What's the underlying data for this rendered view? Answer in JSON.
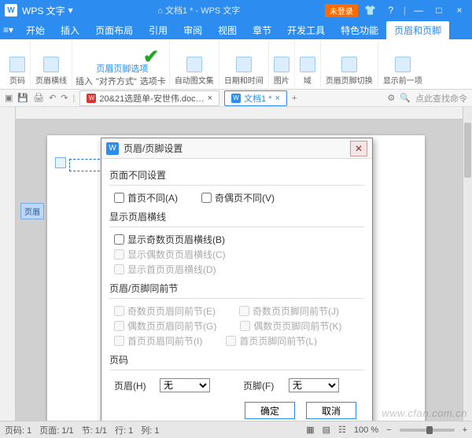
{
  "titlebar": {
    "app": "WPS 文字",
    "center": "⌂ 文档1 * - WPS 文字",
    "login": "未登录",
    "icons": {
      "shirt": "👕",
      "help": "?",
      "min": "—",
      "max": "□",
      "close": "×"
    }
  },
  "menubar": {
    "tabs": [
      "开始",
      "插入",
      "页面布局",
      "引用",
      "审阅",
      "视图",
      "章节",
      "开发工具",
      "特色功能",
      "页眉和页脚"
    ]
  },
  "ribbon": {
    "pagenum": "页码",
    "headerline": "页眉横线",
    "insert": "插入",
    "align": "\"对齐方式\"",
    "options_line1": "页眉页脚选项",
    "options_line2": "选项卡",
    "autotext": "自动图文集",
    "datetime": "日期和时间",
    "picture": "图片",
    "field": "域",
    "switch": "页眉页脚切换",
    "showprev": "显示前一项"
  },
  "quick": {
    "doc1_name": "20&21选题单-安世伟.doc…",
    "doc2_name": "文档1 *",
    "search": "点此查找命令"
  },
  "pagepanel": {
    "header_tag": "页眉"
  },
  "dialog": {
    "title": "页眉/页脚设置",
    "sec_page": "页面不同设置",
    "first_diff": "首页不同(A)",
    "oddeven_diff": "奇偶页不同(V)",
    "sec_line": "显示页眉横线",
    "odd_line": "显示奇数页页眉横线(B)",
    "even_line": "显示偶数页页眉横线(C)",
    "first_line": "显示首页页眉横线(D)",
    "sec_same": "页眉/页脚同前节",
    "odd_hdr_same": "奇数页页眉同前节(E)",
    "odd_ftr_same": "奇数页页脚同前节(J)",
    "even_hdr_same": "偶数页页眉同前节(G)",
    "even_ftr_same": "偶数页页脚同前节(K)",
    "first_hdr_same": "首页页眉同前节(I)",
    "first_ftr_same": "首页页脚同前节(L)",
    "sec_num": "页码",
    "hdr_label": "页眉(H)",
    "ftr_label": "页脚(F)",
    "opt_none": "无",
    "ok": "确定",
    "cancel": "取消"
  },
  "status": {
    "page": "页码: 1",
    "pages": "页面: 1/1",
    "section": "节: 1/1",
    "line": "行: 1",
    "col": "列: 1",
    "zoom": "100 %",
    "minus": "−",
    "plus": "+"
  },
  "watermark": "www.cfan.com.cn"
}
